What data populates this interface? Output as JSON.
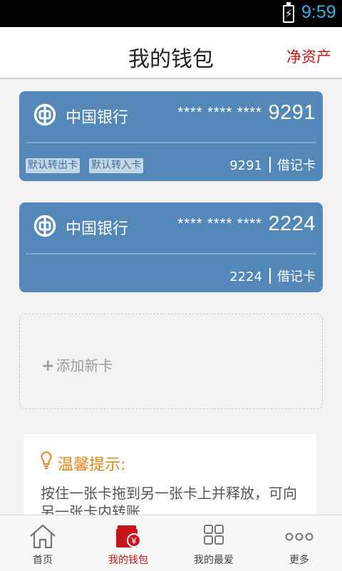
{
  "status_bar": {
    "time": "9:59",
    "battery_icon": "battery-charging-icon"
  },
  "header": {
    "title": "我的钱包",
    "action_label": "净资产"
  },
  "cards": [
    {
      "bank": "中国银行",
      "number_mask": "**** **** ****",
      "number_last4": "9291",
      "tags": [
        "默认转出卡",
        "默认转入卡"
      ],
      "foot_last4": "9291",
      "card_type": "借记卡"
    },
    {
      "bank": "中国银行",
      "number_mask": "**** **** ****",
      "number_last4": "2224",
      "tags": [],
      "foot_last4": "2224",
      "card_type": "借记卡"
    }
  ],
  "add_card": {
    "icon": "plus-icon",
    "label": "添加新卡"
  },
  "tip": {
    "icon": "lightbulb-icon",
    "title": "温馨提示:",
    "text": "按住一张卡拖到另一张卡上并释放，可向另一张卡内转账"
  },
  "bottom_nav": [
    {
      "label": "首页",
      "icon": "home-icon",
      "active": false
    },
    {
      "label": "我的钱包",
      "icon": "wallet-icon",
      "active": true
    },
    {
      "label": "我的最爱",
      "icon": "favorites-grid-icon",
      "active": false
    },
    {
      "label": "更多",
      "icon": "more-dots-icon",
      "active": false
    }
  ],
  "colors": {
    "card": "#5388b8",
    "accent_red": "#c8141a",
    "tip_orange": "#e8841a",
    "clock_blue": "#33b5e5"
  }
}
